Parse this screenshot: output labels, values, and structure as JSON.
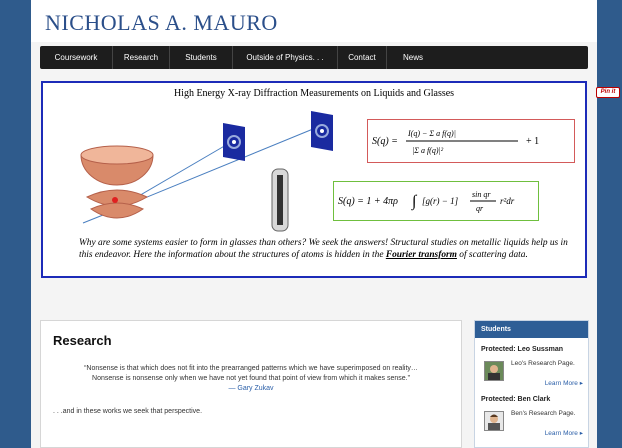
{
  "site": {
    "title": "NICHOLAS A. MAURO"
  },
  "nav": {
    "items": [
      "Coursework",
      "Research",
      "Students",
      "Outside of Physics. . .",
      "Contact",
      "News"
    ]
  },
  "banner": {
    "title": "High Energy X-ray Diffraction Measurements on Liquids and Glasses",
    "text_before": "Why are some systems easier to form in glasses than others?  We seek the answers!  Structural studies on metallic liquids help us in this endeavor.  Here the information about the structures of atoms is hidden in the ",
    "link": "Fourier transform",
    "text_after": " of scattering data."
  },
  "pinit": {
    "label": "Pin it"
  },
  "content": {
    "heading": "Research",
    "quote_line1": "“Nonsense is that which does not fit into the prearranged patterns which we have superimposed on reality…",
    "quote_line2": "Nonsense is nonsense only when we have not yet found that point of view from which it makes sense.”",
    "quote_author": "— Gary Zukav",
    "follow": ". . .and in these works we seek that perspective."
  },
  "sidebar": {
    "header": "Students",
    "students": [
      {
        "name": "Protected: Leo Sussman",
        "desc": "Leo's Research Page.",
        "more": "Learn More ▸"
      },
      {
        "name": "Protected: Ben Clark",
        "desc": "Ben's Research Page.",
        "more": "Learn More ▸"
      }
    ]
  }
}
